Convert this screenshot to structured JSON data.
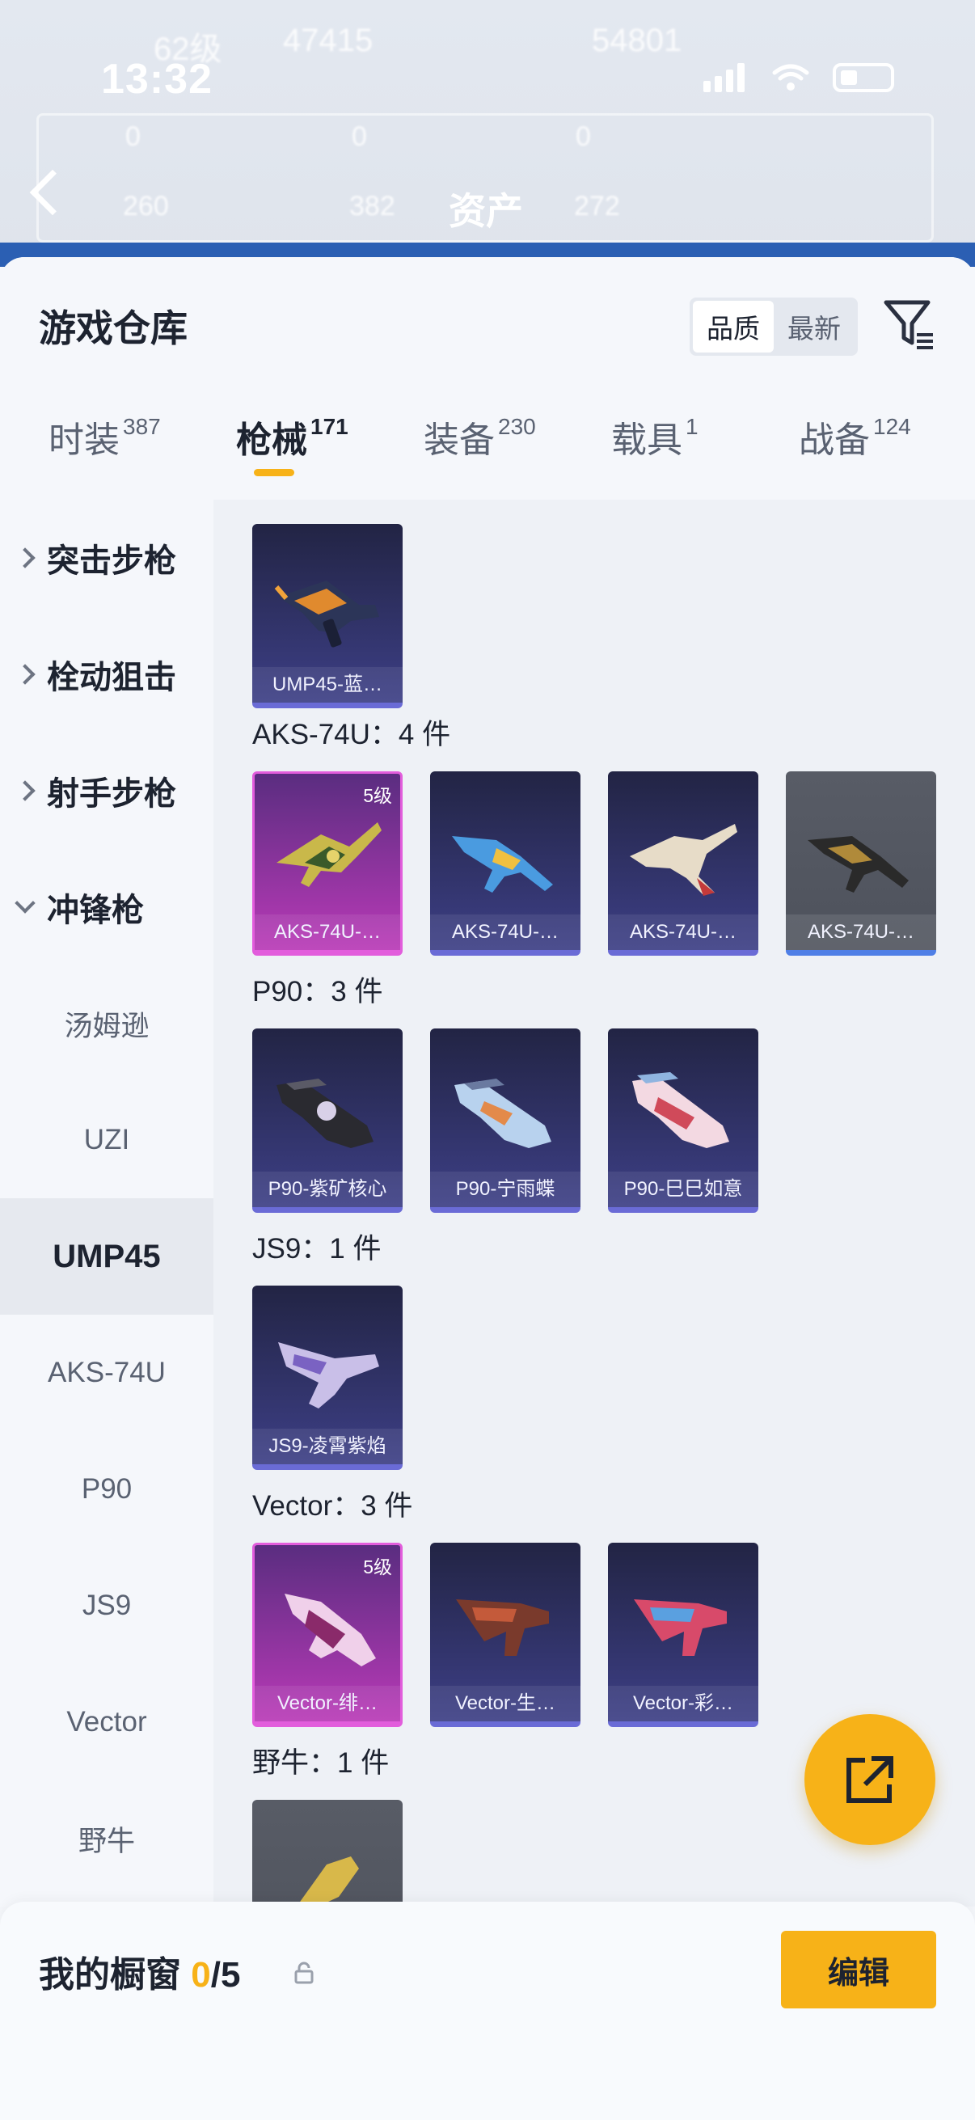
{
  "status_bar": {
    "time": "13:32"
  },
  "background": {
    "row1": [
      "62级",
      "47415",
      "54801"
    ],
    "row2": [
      "0",
      "0",
      "0"
    ],
    "row3": [
      "260",
      "382",
      "272"
    ],
    "title": "资产"
  },
  "sheet": {
    "title": "游戏仓库",
    "sort": {
      "options": [
        "品质",
        "最新"
      ],
      "active": "品质"
    }
  },
  "tabs": [
    {
      "label": "时装",
      "count": "387"
    },
    {
      "label": "枪械",
      "count": "171",
      "active": true
    },
    {
      "label": "装备",
      "count": "230"
    },
    {
      "label": "载具",
      "count": "1"
    },
    {
      "label": "战备",
      "count": "124"
    }
  ],
  "sidebar": {
    "categories": [
      {
        "label": "突击步枪",
        "expanded": false
      },
      {
        "label": "栓动狙击",
        "expanded": false
      },
      {
        "label": "射手步枪",
        "expanded": false
      },
      {
        "label": "冲锋枪",
        "expanded": true
      }
    ],
    "subitems": [
      "汤姆逊",
      "UZI",
      "UMP45",
      "AKS-74U",
      "P90",
      "JS9",
      "Vector",
      "野牛"
    ],
    "active_subitem": "UMP45"
  },
  "groups": {
    "ump45": {
      "cards": [
        {
          "name": "UMP45-蓝…"
        }
      ]
    },
    "aks": {
      "title": "AKS-74U：4 件",
      "cards": [
        {
          "name": "AKS-74U-…",
          "level": "5级"
        },
        {
          "name": "AKS-74U-…"
        },
        {
          "name": "AKS-74U-…"
        },
        {
          "name": "AKS-74U-…"
        }
      ]
    },
    "p90": {
      "title": "P90：3 件",
      "cards": [
        {
          "name": "P90-紫矿核心"
        },
        {
          "name": "P90-宁雨蝶"
        },
        {
          "name": "P90-巳巳如意"
        }
      ]
    },
    "js9": {
      "title": "JS9：1 件",
      "cards": [
        {
          "name": "JS9-凌霄紫焰"
        }
      ]
    },
    "vector": {
      "title": "Vector：3 件",
      "cards": [
        {
          "name": "Vector-绯…",
          "level": "5级"
        },
        {
          "name": "Vector-生…"
        },
        {
          "name": "Vector-彩…"
        }
      ]
    },
    "bison": {
      "title": "野牛：1 件"
    }
  },
  "bottom_bar": {
    "label": "我的橱窗",
    "count": "0",
    "total": "/5",
    "edit_label": "编辑"
  },
  "colors": {
    "accent": "#f7b218",
    "purple_rarity": "#6a6bd6",
    "pink_rarity": "#e25ddc",
    "blue_rarity": "#4f7fe6"
  }
}
